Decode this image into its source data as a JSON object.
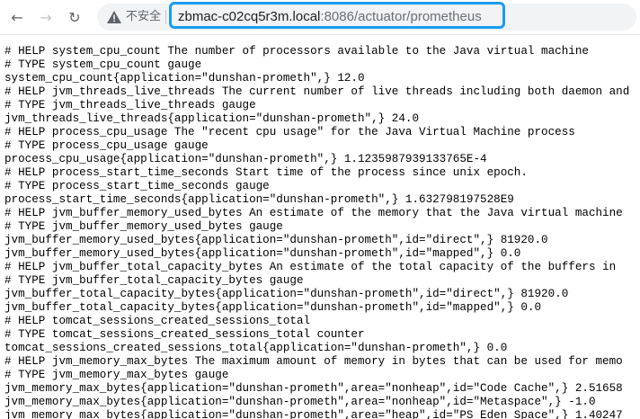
{
  "browser": {
    "security_label": "不安全",
    "url_host": "zbmac-c02cq5r3m.local",
    "url_path": ":8086/actuator/prometheus"
  },
  "metrics_lines": [
    "# HELP system_cpu_count The number of processors available to the Java virtual machine",
    "# TYPE system_cpu_count gauge",
    "system_cpu_count{application=\"dunshan-prometh\",} 12.0",
    "# HELP jvm_threads_live_threads The current number of live threads including both daemon and",
    "# TYPE jvm_threads_live_threads gauge",
    "jvm_threads_live_threads{application=\"dunshan-prometh\",} 24.0",
    "# HELP process_cpu_usage The \"recent cpu usage\" for the Java Virtual Machine process",
    "# TYPE process_cpu_usage gauge",
    "process_cpu_usage{application=\"dunshan-prometh\",} 1.1235987939133765E-4",
    "# HELP process_start_time_seconds Start time of the process since unix epoch.",
    "# TYPE process_start_time_seconds gauge",
    "process_start_time_seconds{application=\"dunshan-prometh\",} 1.632798197528E9",
    "# HELP jvm_buffer_memory_used_bytes An estimate of the memory that the Java virtual machine",
    "# TYPE jvm_buffer_memory_used_bytes gauge",
    "jvm_buffer_memory_used_bytes{application=\"dunshan-prometh\",id=\"direct\",} 81920.0",
    "jvm_buffer_memory_used_bytes{application=\"dunshan-prometh\",id=\"mapped\",} 0.0",
    "# HELP jvm_buffer_total_capacity_bytes An estimate of the total capacity of the buffers in",
    "# TYPE jvm_buffer_total_capacity_bytes gauge",
    "jvm_buffer_total_capacity_bytes{application=\"dunshan-prometh\",id=\"direct\",} 81920.0",
    "jvm_buffer_total_capacity_bytes{application=\"dunshan-prometh\",id=\"mapped\",} 0.0",
    "# HELP tomcat_sessions_created_sessions_total",
    "# TYPE tomcat_sessions_created_sessions_total counter",
    "tomcat_sessions_created_sessions_total{application=\"dunshan-prometh\",} 0.0",
    "# HELP jvm_memory_max_bytes The maximum amount of memory in bytes that can be used for memo",
    "# TYPE jvm_memory_max_bytes gauge",
    "jvm_memory_max_bytes{application=\"dunshan-prometh\",area=\"nonheap\",id=\"Code Cache\",} 2.51658",
    "jvm_memory_max_bytes{application=\"dunshan-prometh\",area=\"nonheap\",id=\"Metaspace\",} -1.0",
    "jvm_memory_max_bytes{application=\"dunshan-prometh\",area=\"heap\",id=\"PS Eden Space\",} 1.40247"
  ]
}
